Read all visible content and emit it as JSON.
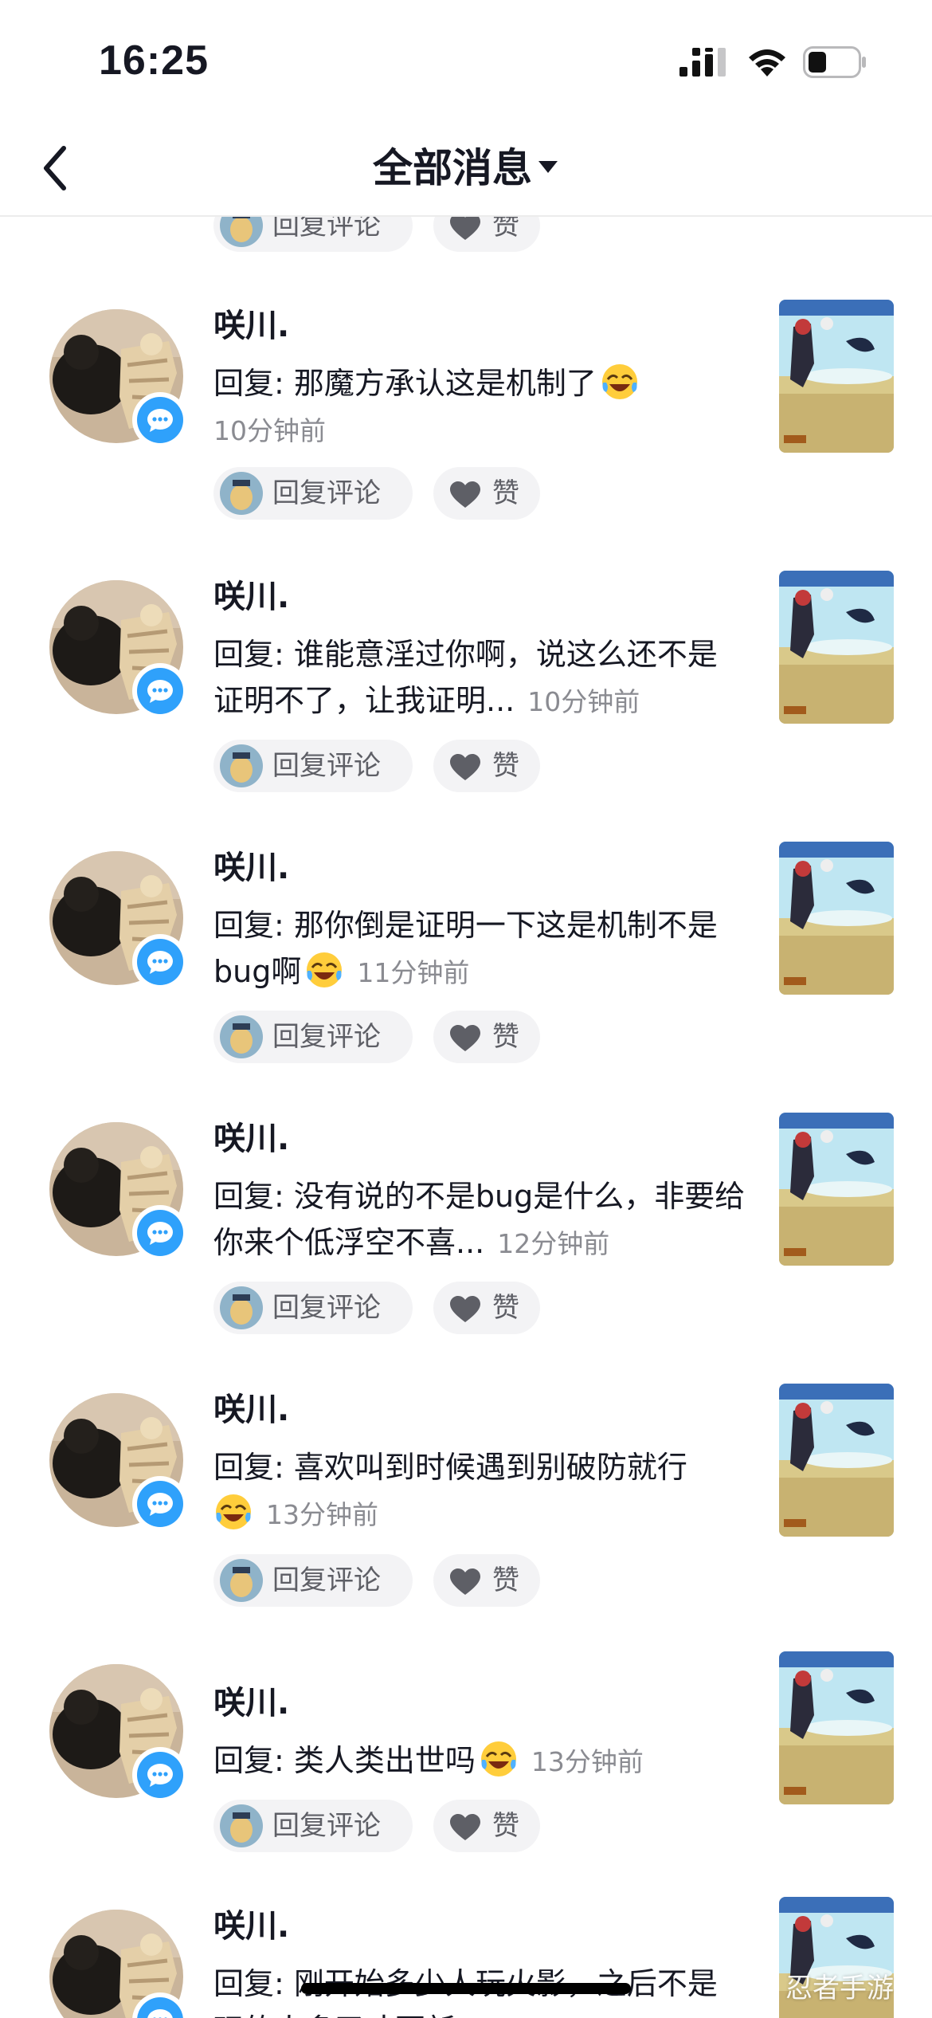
{
  "status_bar": {
    "time": "16:25"
  },
  "nav": {
    "title": "全部消息"
  },
  "actions": {
    "reply_label": "回复评论",
    "like_label": "赞"
  },
  "messages": [
    {
      "username": "咲川.",
      "prefix": "回复: ",
      "text": "那魔方承认这是机制了",
      "emoji": true,
      "time": "10分钟前",
      "time_layout": "own-line"
    },
    {
      "username": "咲川.",
      "prefix": "回复: ",
      "text": "谁能意淫过你啊，说这么还不是证明不了，让我证明...",
      "emoji": false,
      "time": "10分钟前",
      "time_layout": "inline"
    },
    {
      "username": "咲川.",
      "prefix": "回复: ",
      "text": "那你倒是证明一下这是机制不是bug啊",
      "emoji": true,
      "time": "11分钟前",
      "time_layout": "inline"
    },
    {
      "username": "咲川.",
      "prefix": "回复: ",
      "text": "没有说的不是bug是什么，非要给你来个低浮空不喜...",
      "emoji": false,
      "time": "12分钟前",
      "time_layout": "inline"
    },
    {
      "username": "咲川.",
      "prefix": "回复: ",
      "text": "喜欢叫到时候遇到别破防就行",
      "emoji": true,
      "time": "13分钟前",
      "time_layout": "inline"
    },
    {
      "username": "咲川.",
      "prefix": "回复: ",
      "text": "类人类出世吗",
      "emoji": true,
      "time": "13分钟前",
      "time_layout": "inline"
    },
    {
      "username": "咲川.",
      "prefix": "回复: ",
      "text": "刚开始多少人玩火影，之后不是玩的人多了才更新",
      "emoji": false,
      "time": "",
      "time_layout": "inline"
    }
  ],
  "watermark": "忍者手游",
  "colors": {
    "accent_blue": "#2fa1fb",
    "time_gray": "#8a8b91",
    "button_bg": "#f3f3f5"
  }
}
